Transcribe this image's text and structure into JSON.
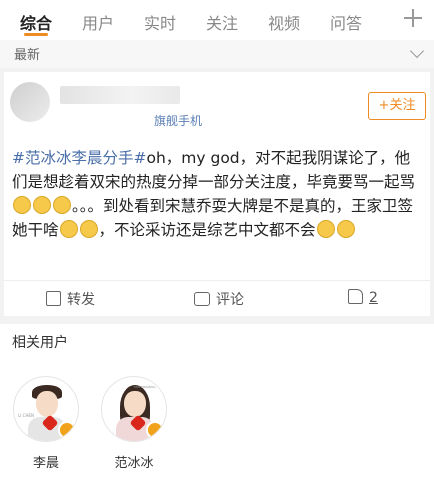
{
  "tabs": [
    {
      "label": "综合",
      "active": true
    },
    {
      "label": "用户",
      "active": false
    },
    {
      "label": "实时",
      "active": false
    },
    {
      "label": "关注",
      "active": false
    },
    {
      "label": "视频",
      "active": false
    },
    {
      "label": "问答",
      "active": false
    }
  ],
  "recent_label": "最新",
  "post": {
    "source": "旗舰手机",
    "follow_label": "+关注",
    "hashtag": "#范冰冰李晨分手#",
    "text_1": "oh，my god，对不起我阴谋论了，他们是想趁着双宋的热度分掉一部分关注度，毕竟要骂一起骂",
    "text_2": "。。。到处看到宋慧乔耍大牌是不是真的，王家卫签她干啥",
    "text_3": "，不论采访还是综艺中文都不会",
    "share_label": "转发",
    "comment_label": "评论",
    "like_count": "2"
  },
  "related": {
    "title": "相关用户",
    "users": [
      {
        "name": "李晨",
        "avatar_caption": "LI CHEN"
      },
      {
        "name": "范冰冰",
        "avatar_caption": "FAN BINGBING"
      }
    ]
  },
  "colors": {
    "accent": "#f08a24",
    "link": "#4a6fa8",
    "verified": "#f0a31a"
  }
}
